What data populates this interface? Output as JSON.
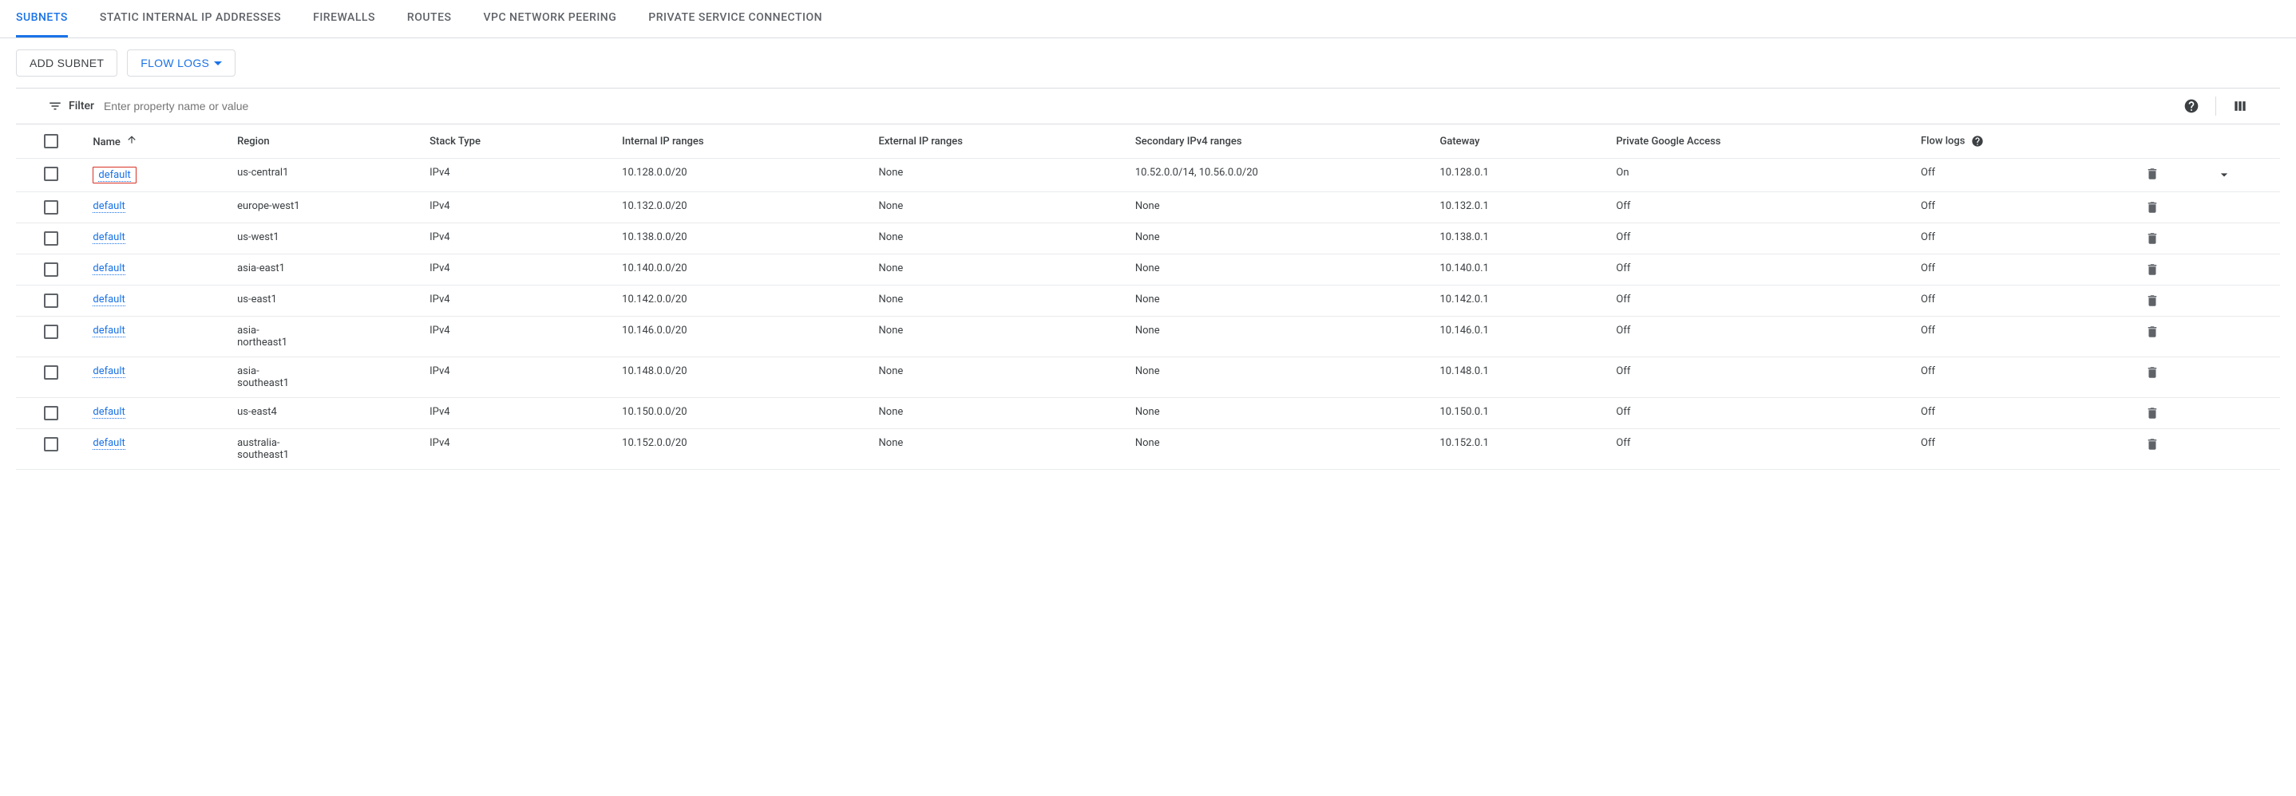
{
  "tabs": [
    {
      "label": "SUBNETS",
      "active": true
    },
    {
      "label": "STATIC INTERNAL IP ADDRESSES",
      "active": false
    },
    {
      "label": "FIREWALLS",
      "active": false
    },
    {
      "label": "ROUTES",
      "active": false
    },
    {
      "label": "VPC NETWORK PEERING",
      "active": false
    },
    {
      "label": "PRIVATE SERVICE CONNECTION",
      "active": false
    }
  ],
  "actions": {
    "add_subnet_label": "ADD SUBNET",
    "flow_logs_label": "FLOW LOGS"
  },
  "filter": {
    "label": "Filter",
    "placeholder": "Enter property name or value"
  },
  "columns": {
    "name": "Name",
    "region": "Region",
    "stack_type": "Stack Type",
    "internal_ip": "Internal IP ranges",
    "external_ip": "External IP ranges",
    "secondary_ip": "Secondary IPv4 ranges",
    "gateway": "Gateway",
    "pga": "Private Google Access",
    "flow_logs": "Flow logs"
  },
  "rows": [
    {
      "name": "default",
      "region": "us-central1",
      "stack": "IPv4",
      "internal": "10.128.0.0/20",
      "external": "None",
      "secondary": "10.52.0.0/14, 10.56.0.0/20",
      "gateway": "10.128.0.1",
      "pga": "On",
      "flow": "Off",
      "highlighted": true,
      "expandable": true
    },
    {
      "name": "default",
      "region": "europe-west1",
      "stack": "IPv4",
      "internal": "10.132.0.0/20",
      "external": "None",
      "secondary": "None",
      "gateway": "10.132.0.1",
      "pga": "Off",
      "flow": "Off"
    },
    {
      "name": "default",
      "region": "us-west1",
      "stack": "IPv4",
      "internal": "10.138.0.0/20",
      "external": "None",
      "secondary": "None",
      "gateway": "10.138.0.1",
      "pga": "Off",
      "flow": "Off"
    },
    {
      "name": "default",
      "region": "asia-east1",
      "stack": "IPv4",
      "internal": "10.140.0.0/20",
      "external": "None",
      "secondary": "None",
      "gateway": "10.140.0.1",
      "pga": "Off",
      "flow": "Off"
    },
    {
      "name": "default",
      "region": "us-east1",
      "stack": "IPv4",
      "internal": "10.142.0.0/20",
      "external": "None",
      "secondary": "None",
      "gateway": "10.142.0.1",
      "pga": "Off",
      "flow": "Off"
    },
    {
      "name": "default",
      "region": "asia-northeast1",
      "stack": "IPv4",
      "internal": "10.146.0.0/20",
      "external": "None",
      "secondary": "None",
      "gateway": "10.146.0.1",
      "pga": "Off",
      "flow": "Off"
    },
    {
      "name": "default",
      "region": "asia-southeast1",
      "stack": "IPv4",
      "internal": "10.148.0.0/20",
      "external": "None",
      "secondary": "None",
      "gateway": "10.148.0.1",
      "pga": "Off",
      "flow": "Off"
    },
    {
      "name": "default",
      "region": "us-east4",
      "stack": "IPv4",
      "internal": "10.150.0.0/20",
      "external": "None",
      "secondary": "None",
      "gateway": "10.150.0.1",
      "pga": "Off",
      "flow": "Off"
    },
    {
      "name": "default",
      "region": "australia-southeast1",
      "stack": "IPv4",
      "internal": "10.152.0.0/20",
      "external": "None",
      "secondary": "None",
      "gateway": "10.152.0.1",
      "pga": "Off",
      "flow": "Off"
    }
  ]
}
